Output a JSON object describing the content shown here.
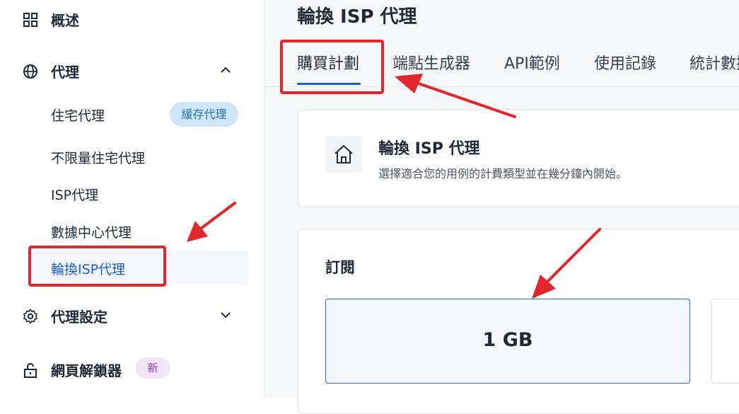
{
  "sidebar": {
    "overview": {
      "label": "概述",
      "icon": "dashboard-grid-icon"
    },
    "proxy": {
      "label": "代理",
      "icon": "globe-icon",
      "expanded": true
    },
    "proxy_items": [
      {
        "label": "住宅代理",
        "badge": "緩存代理"
      },
      {
        "label": "不限量住宅代理"
      },
      {
        "label": "ISP代理"
      },
      {
        "label": "數據中心代理"
      },
      {
        "label": "輪換ISP代理",
        "active": true
      }
    ],
    "proxy_settings": {
      "label": "代理設定",
      "icon": "gear-icon"
    },
    "web_unlocker": {
      "label": "網頁解鎖器",
      "icon": "unlock-icon",
      "badge": "新"
    }
  },
  "main": {
    "page_title": "輪換 ISP 代理",
    "tabs": [
      {
        "label": "購買計劃",
        "active": true
      },
      {
        "label": "端點生成器"
      },
      {
        "label": "API範例"
      },
      {
        "label": "使用記錄"
      },
      {
        "label": "統計數據"
      }
    ],
    "info_card": {
      "icon": "home-icon",
      "title": "輪換 ISP 代理",
      "description": "選擇適合您的用例的計費類型並在幾分鐘內開始。"
    },
    "subscription": {
      "title": "訂閱",
      "plans": [
        {
          "label": "1 GB",
          "selected": true
        }
      ]
    }
  },
  "colors": {
    "accent": "#1a5fd0",
    "annotation": "#e3262b",
    "badge_cache_bg": "#cfe6f8",
    "badge_new_bg": "#f1e4f8"
  }
}
